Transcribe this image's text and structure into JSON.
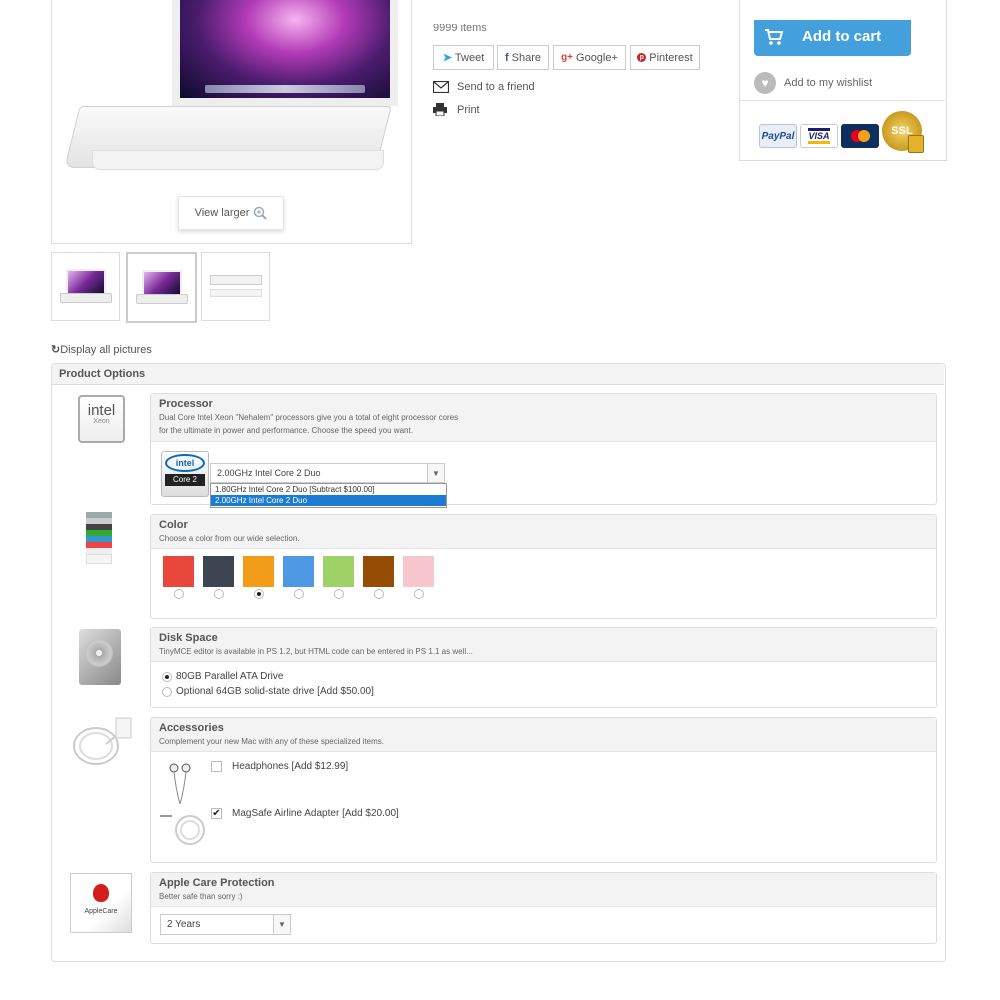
{
  "gallery": {
    "view_larger": "View larger",
    "display_all": "Display all pictures"
  },
  "stock": {
    "items_cut": "9999 items"
  },
  "social": {
    "tweet": "Tweet",
    "share": "Share",
    "google": "Google+",
    "pinterest": "Pinterest"
  },
  "actions": {
    "send_friend": "Send to a friend",
    "print": "Print"
  },
  "cart": {
    "add_to_cart": "Add to cart",
    "wishlist": "Add to my wishlist",
    "payments": [
      "PayPal",
      "VISA",
      "MasterCard",
      "SSL"
    ]
  },
  "product_options": {
    "title": "Product Options",
    "processor": {
      "title": "Processor",
      "desc1": "Dual Core Intel Xeon \"Nehalem\" processors give you a total of eight processor cores",
      "desc2": "for the ultimate in power and performance. Choose the speed you want.",
      "selected": "2.00GHz Intel Core 2 Duo",
      "options": [
        "1.80GHz Intel Core 2 Duo  [Subtract $100.00]",
        "2.00GHz Intel Core 2 Duo"
      ],
      "logo_intel": "intel",
      "logo_xeon": "Xeon",
      "logo_core": "Core 2",
      "logo_inside": "intel"
    },
    "color": {
      "title": "Color",
      "desc": "Choose a color from our wide selection.",
      "swatches": [
        "#e8473c",
        "#3e4550",
        "#f29d19",
        "#4f98e4",
        "#9fd266",
        "#954c05",
        "#f8c7ce"
      ],
      "selected_index": 2
    },
    "disk": {
      "title": "Disk Space",
      "desc": "TinyMCE editor is available in PS 1.2, but HTML code can be entered in PS 1.1 as well...",
      "option1": "80GB Parallel ATA Drive",
      "option2": "Optional 64GB solid-state drive [Add $50.00]"
    },
    "accessories": {
      "title": "Accessories",
      "desc": "Complement your new Mac with any of these specialized items.",
      "item1": "Headphones [Add $12.99]",
      "item2": "MagSafe Airline Adapter [Add $20.00]"
    },
    "applecare": {
      "title": "Apple Care Protection",
      "desc": "Better safe than sorry :)",
      "selected": "2 Years",
      "box_label": "AppleCare"
    }
  }
}
